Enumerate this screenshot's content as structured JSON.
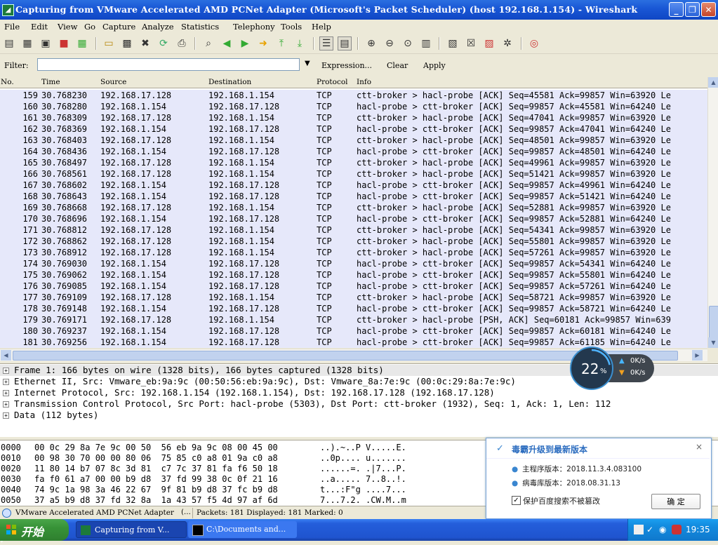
{
  "window": {
    "title": "Capturing from VMware Accelerated AMD PCNet Adapter (Microsoft's Packet Scheduler)  (host 192.168.1.154) - Wireshark",
    "icon": "wireshark-fin-icon",
    "minimize": "_",
    "maximize": "❐",
    "close": "✕"
  },
  "menu": [
    "File",
    "Edit",
    "View",
    "Go",
    "Capture",
    "Analyze",
    "Statistics",
    "Telephony",
    "Tools",
    "Help"
  ],
  "toolbar": {
    "icons": [
      "interface-list-icon",
      "capture-options-icon",
      "start-capture-icon",
      "stop-capture-icon",
      "restart-capture-icon",
      "open-file-icon",
      "save-file-icon",
      "close-file-icon",
      "reload-icon",
      "print-icon",
      "find-packet-icon",
      "go-back-icon",
      "go-forward-icon",
      "go-to-packet-icon",
      "first-packet-icon",
      "last-packet-icon",
      "colorize-icon",
      "auto-scroll-icon",
      "zoom-in-icon",
      "zoom-out-icon",
      "normal-size-icon",
      "resize-columns-icon",
      "capture-filters-icon",
      "display-filters-icon",
      "coloring-rules-icon",
      "preferences-icon",
      "help-icon"
    ]
  },
  "filter": {
    "label": "Filter:",
    "value": "",
    "expression": "Expression...",
    "clear": "Clear",
    "apply": "Apply"
  },
  "packet_list": {
    "headers": [
      "No.",
      "Time",
      "Source",
      "Destination",
      "Protocol",
      "Info"
    ],
    "rows": [
      [
        "159",
        "30.768230",
        "192.168.17.128",
        "192.168.1.154",
        "TCP",
        "ctt-broker > hacl-probe [ACK] Seq=45581 Ack=99857 Win=63920 Le"
      ],
      [
        "160",
        "30.768280",
        "192.168.1.154",
        "192.168.17.128",
        "TCP",
        "hacl-probe > ctt-broker [ACK] Seq=99857 Ack=45581 Win=64240 Le"
      ],
      [
        "161",
        "30.768309",
        "192.168.17.128",
        "192.168.1.154",
        "TCP",
        "ctt-broker > hacl-probe [ACK] Seq=47041 Ack=99857 Win=63920 Le"
      ],
      [
        "162",
        "30.768369",
        "192.168.1.154",
        "192.168.17.128",
        "TCP",
        "hacl-probe > ctt-broker [ACK] Seq=99857 Ack=47041 Win=64240 Le"
      ],
      [
        "163",
        "30.768403",
        "192.168.17.128",
        "192.168.1.154",
        "TCP",
        "ctt-broker > hacl-probe [ACK] Seq=48501 Ack=99857 Win=63920 Le"
      ],
      [
        "164",
        "30.768436",
        "192.168.1.154",
        "192.168.17.128",
        "TCP",
        "hacl-probe > ctt-broker [ACK] Seq=99857 Ack=48501 Win=64240 Le"
      ],
      [
        "165",
        "30.768497",
        "192.168.17.128",
        "192.168.1.154",
        "TCP",
        "ctt-broker > hacl-probe [ACK] Seq=49961 Ack=99857 Win=63920 Le"
      ],
      [
        "166",
        "30.768561",
        "192.168.17.128",
        "192.168.1.154",
        "TCP",
        "ctt-broker > hacl-probe [ACK] Seq=51421 Ack=99857 Win=63920 Le"
      ],
      [
        "167",
        "30.768602",
        "192.168.1.154",
        "192.168.17.128",
        "TCP",
        "hacl-probe > ctt-broker [ACK] Seq=99857 Ack=49961 Win=64240 Le"
      ],
      [
        "168",
        "30.768643",
        "192.168.1.154",
        "192.168.17.128",
        "TCP",
        "hacl-probe > ctt-broker [ACK] Seq=99857 Ack=51421 Win=64240 Le"
      ],
      [
        "169",
        "30.768668",
        "192.168.17.128",
        "192.168.1.154",
        "TCP",
        "ctt-broker > hacl-probe [ACK] Seq=52881 Ack=99857 Win=63920 Le"
      ],
      [
        "170",
        "30.768696",
        "192.168.1.154",
        "192.168.17.128",
        "TCP",
        "hacl-probe > ctt-broker [ACK] Seq=99857 Ack=52881 Win=64240 Le"
      ],
      [
        "171",
        "30.768812",
        "192.168.17.128",
        "192.168.1.154",
        "TCP",
        "ctt-broker > hacl-probe [ACK] Seq=54341 Ack=99857 Win=63920 Le"
      ],
      [
        "172",
        "30.768862",
        "192.168.17.128",
        "192.168.1.154",
        "TCP",
        "ctt-broker > hacl-probe [ACK] Seq=55801 Ack=99857 Win=63920 Le"
      ],
      [
        "173",
        "30.768912",
        "192.168.17.128",
        "192.168.1.154",
        "TCP",
        "ctt-broker > hacl-probe [ACK] Seq=57261 Ack=99857 Win=63920 Le"
      ],
      [
        "174",
        "30.769030",
        "192.168.1.154",
        "192.168.17.128",
        "TCP",
        "hacl-probe > ctt-broker [ACK] Seq=99857 Ack=54341 Win=64240 Le"
      ],
      [
        "175",
        "30.769062",
        "192.168.1.154",
        "192.168.17.128",
        "TCP",
        "hacl-probe > ctt-broker [ACK] Seq=99857 Ack=55801 Win=64240 Le"
      ],
      [
        "176",
        "30.769085",
        "192.168.1.154",
        "192.168.17.128",
        "TCP",
        "hacl-probe > ctt-broker [ACK] Seq=99857 Ack=57261 Win=64240 Le"
      ],
      [
        "177",
        "30.769109",
        "192.168.17.128",
        "192.168.1.154",
        "TCP",
        "ctt-broker > hacl-probe [ACK] Seq=58721 Ack=99857 Win=63920 Le"
      ],
      [
        "178",
        "30.769148",
        "192.168.1.154",
        "192.168.17.128",
        "TCP",
        "hacl-probe > ctt-broker [ACK] Seq=99857 Ack=58721 Win=64240 Le"
      ],
      [
        "179",
        "30.769171",
        "192.168.17.128",
        "192.168.1.154",
        "TCP",
        "ctt-broker > hacl-probe [PSH, ACK] Seq=60181 Ack=99857 Win=639"
      ],
      [
        "180",
        "30.769237",
        "192.168.1.154",
        "192.168.17.128",
        "TCP",
        "hacl-probe > ctt-broker [ACK] Seq=99857 Ack=60181 Win=64240 Le"
      ],
      [
        "181",
        "30.769256",
        "192.168.1.154",
        "192.168.17.128",
        "TCP",
        "hacl-probe > ctt-broker [ACK] Seq=99857 Ack=61185 Win=64240 Le"
      ]
    ]
  },
  "details": [
    "Frame 1: 166 bytes on wire (1328 bits), 166 bytes captured (1328 bits)",
    "Ethernet II, Src: Vmware_eb:9a:9c (00:50:56:eb:9a:9c), Dst: Vmware_8a:7e:9c (00:0c:29:8a:7e:9c)",
    "Internet Protocol, Src: 192.168.1.154 (192.168.1.154), Dst: 192.168.17.128 (192.168.17.128)",
    "Transmission Control Protocol, Src Port: hacl-probe (5303), Dst Port: ctt-broker (1932), Seq: 1, Ack: 1, Len: 112",
    "Data (112 bytes)"
  ],
  "hex": [
    [
      "0000",
      "00 0c 29 8a 7e 9c 00 50  56 eb 9a 9c 08 00 45 00",
      "..).~..P V.....E."
    ],
    [
      "0010",
      "00 98 30 70 00 00 80 06  75 85 c0 a8 01 9a c0 a8",
      "..0p.... u......."
    ],
    [
      "0020",
      "11 80 14 b7 07 8c 3d 81  c7 7c 37 81 fa f6 50 18",
      "......=. .|7...P."
    ],
    [
      "0030",
      "fa f0 61 a7 00 00 b9 d8  37 fd 99 38 0c 0f 21 16",
      "..a..... 7..8..!."
    ],
    [
      "0040",
      "74 9c 1a 98 3a 46 22 67  9f 81 b9 d8 37 fc b9 d8",
      "t...:F\"g ....7..."
    ],
    [
      "0050",
      "37 a5 b9 d8 37 fd 32 8a  1a 43 57 f5 4d 97 af 6d",
      "7...7.2. .CW.M..m"
    ],
    [
      "0060",
      "e7 83 2f 0f 25 bd 1b e5  79 38 a2 3d 87 83 fd 48",
      "../.%... y8.=...H"
    ]
  ],
  "status": {
    "interface": "VMware Accelerated AMD PCNet Adapter",
    "more": "(…",
    "packets": "Packets: 181 Displayed: 181 Marked: 0"
  },
  "net_widget": {
    "percent": "22",
    "percent_symbol": "%",
    "upload": "0K/s",
    "download": "0K/s",
    "usage_fraction": 0.22
  },
  "popup": {
    "title": "毒霸升级到最新版本",
    "line1": "主程序版本：2018.11.3.4.083100",
    "line2": "病毒库版本：2018.08.31.13",
    "checkbox_label": "保护百度搜索不被篡改",
    "checked": true,
    "ok": "确 定",
    "close": "×"
  },
  "taskbar": {
    "start": "开始",
    "items": [
      {
        "label": "Capturing from V...",
        "icon": "wireshark-fin-icon"
      },
      {
        "label": "C:\\Documents and...",
        "icon": "cmd-icon"
      }
    ],
    "clock": "19:35"
  },
  "colors": {
    "row_bg": "#e6e8fa",
    "titlebar": "#1a58d6",
    "taskbar": "#245edb",
    "start": "#379237",
    "accent": "#3a86d0"
  }
}
